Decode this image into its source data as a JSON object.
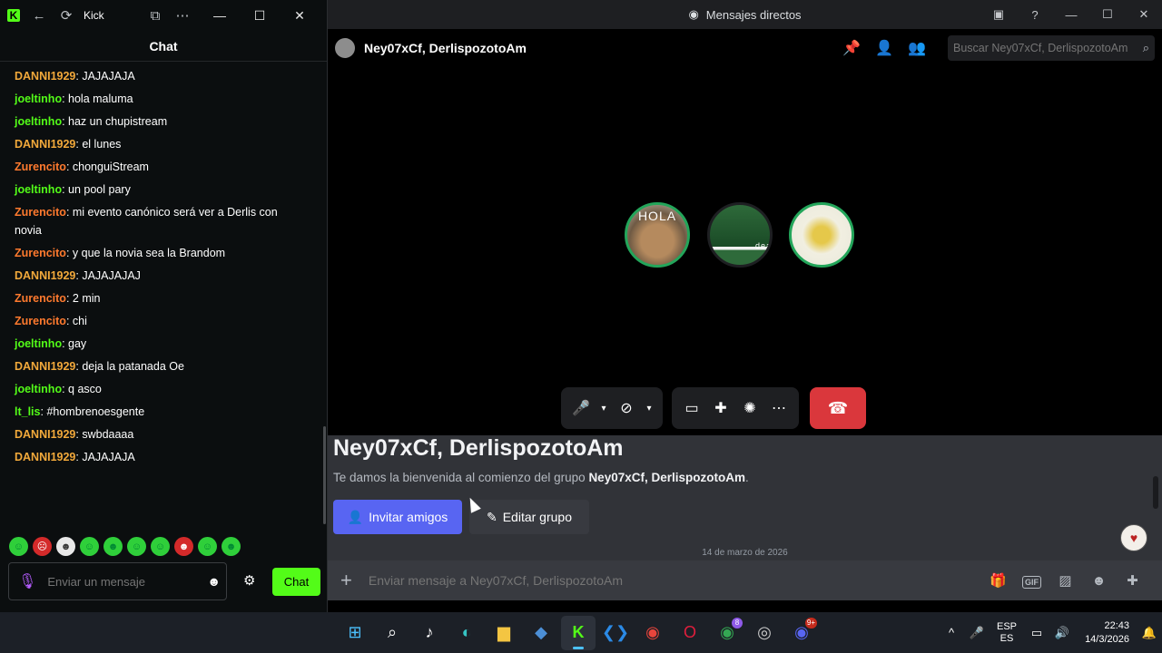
{
  "kick": {
    "app_title": "Kick",
    "chat_title": "Chat",
    "messages": [
      {
        "user": "DANNI1929",
        "color": "#f2a93b",
        "text": ": JAJAJAJA"
      },
      {
        "user": "joeltinho",
        "color": "#53fc18",
        "text": ": hola maluma"
      },
      {
        "user": "joeltinho",
        "color": "#53fc18",
        "text": ": haz un chupistream"
      },
      {
        "user": "DANNI1929",
        "color": "#f2a93b",
        "text": ": el lunes"
      },
      {
        "user": "Zurencito",
        "color": "#ff7a2e",
        "text": ": chonguiStream"
      },
      {
        "user": "joeltinho",
        "color": "#53fc18",
        "text": ": un pool pary"
      },
      {
        "user": "Zurencito",
        "color": "#ff7a2e",
        "text": ": mi evento canónico será ver a Derlis con novia"
      },
      {
        "user": "Zurencito",
        "color": "#ff7a2e",
        "text": ": y que la novia sea la Brandom"
      },
      {
        "user": "DANNI1929",
        "color": "#f2a93b",
        "text": ": JAJAJAJAJ"
      },
      {
        "user": "Zurencito",
        "color": "#ff7a2e",
        "text": ": 2 min"
      },
      {
        "user": "Zurencito",
        "color": "#ff7a2e",
        "text": ": chi"
      },
      {
        "user": "joeltinho",
        "color": "#53fc18",
        "text": ": gay"
      },
      {
        "user": "DANNI1929",
        "color": "#f2a93b",
        "text": ": deja la patanada Oe"
      },
      {
        "user": "joeltinho",
        "color": "#53fc18",
        "text": ": q asco"
      },
      {
        "user": "lt_lis",
        "color": "#53fc18",
        "text": ": #hombrenoesgente"
      },
      {
        "user": "DANNI1929",
        "color": "#f2a93b",
        "text": ": swbdaaaa"
      },
      {
        "user": "DANNI1929",
        "color": "#f2a93b",
        "text": ": JAJAJAJA"
      }
    ],
    "input_placeholder": "Enviar un mensaje",
    "chat_button": "Chat"
  },
  "discord": {
    "window_title": "Mensajes directos",
    "group_name": "Ney07xCf, DerlispozotoAm",
    "search_placeholder": "Buscar Ney07xCf, DerlispozotoAm",
    "avatar_text_1": "HOLA",
    "avatar_text_2": "dea",
    "welcome_prefix": "Te damos la bienvenida al comienzo del grupo ",
    "welcome_group": "Ney07xCf, DerlispozotoAm",
    "welcome_suffix": ".",
    "invite_button": "Invitar amigos",
    "edit_button": "Editar grupo",
    "date_divider": "14 de marzo de 2026",
    "composer_placeholder": "Enviar mensaje a Ney07xCf, DerlispozotoAm",
    "gif_label": "GIF",
    "hangup_color": "#da373c",
    "accent": "#5865f2"
  },
  "taskbar": {
    "lang_top": "ESP",
    "lang_bottom": "ES",
    "time": "22:43",
    "date": "14/3/2026",
    "chrome_badge": "8",
    "discord_badge": "9+"
  }
}
